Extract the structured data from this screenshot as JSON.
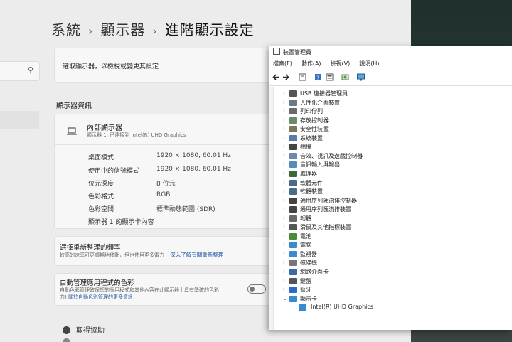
{
  "settings": {
    "breadcrumb": [
      "系統",
      "顯示器",
      "進階顯示設定"
    ],
    "select_display_label": "選取顯示器，以檢視或變更其設定",
    "display_info_title": "顯示器資訊",
    "display": {
      "name": "內部顯示器",
      "subtitle": "顯示器 1: 已連接到 Intel(R) UHD Graphics"
    },
    "specs": [
      {
        "label": "桌面模式",
        "value": "1920 × 1080, 60.01 Hz"
      },
      {
        "label": "使用中的信號模式",
        "value": "1920 × 1080, 60.01 Hz"
      },
      {
        "label": "位元深度",
        "value": "8 位元"
      },
      {
        "label": "色彩格式",
        "value": "RGB"
      },
      {
        "label": "色彩空間",
        "value": "標準動態範圍 (SDR)"
      }
    ],
    "adapter_link": "顯示器 1 的顯示卡內容",
    "refresh": {
      "title": "選擇重新整理的頻率",
      "desc": "較高的速率可更順暢地移動，但也使用更多電力",
      "link": "深入了解有關重新整理"
    },
    "auto_color": {
      "title": "自動管理應用程式的色彩",
      "desc": "自動色彩管理確保您的應用程式和其他內容在此顯示器上具有準確的色彩",
      "desc2": "力)",
      "link": "關於自動色彩管理的更多資訊"
    },
    "get_help": "取得協助"
  },
  "device_manager": {
    "title": "裝置管理員",
    "menu": [
      "檔案(F)",
      "動作(A)",
      "檢視(V)",
      "說明(H)"
    ],
    "categories": [
      {
        "label": "USB 連接器管理員",
        "expanded": false,
        "icon": "usb-icon"
      },
      {
        "label": "人性化介面裝置",
        "expanded": false,
        "icon": "hid-icon"
      },
      {
        "label": "列印佇列",
        "expanded": false,
        "icon": "printer-icon"
      },
      {
        "label": "存放控制器",
        "expanded": false,
        "icon": "storage-icon"
      },
      {
        "label": "安全性裝置",
        "expanded": false,
        "icon": "security-icon"
      },
      {
        "label": "系統裝置",
        "expanded": false,
        "icon": "system-icon"
      },
      {
        "label": "相機",
        "expanded": false,
        "icon": "camera-icon"
      },
      {
        "label": "音效、視訊及遊戲控制器",
        "expanded": false,
        "icon": "audio-icon"
      },
      {
        "label": "音訊輸入與輸出",
        "expanded": false,
        "icon": "speaker-icon"
      },
      {
        "label": "處理器",
        "expanded": false,
        "icon": "processor-icon"
      },
      {
        "label": "軟體元件",
        "expanded": false,
        "icon": "software-component-icon"
      },
      {
        "label": "軟體裝置",
        "expanded": false,
        "icon": "software-device-icon"
      },
      {
        "label": "通用序列匯流排控制器",
        "expanded": false,
        "icon": "usb-controller-icon"
      },
      {
        "label": "通用序列匯流排裝置",
        "expanded": false,
        "icon": "usb-device-icon"
      },
      {
        "label": "韌體",
        "expanded": false,
        "icon": "firmware-icon"
      },
      {
        "label": "滑鼠及其他指標裝置",
        "expanded": false,
        "icon": "mouse-icon"
      },
      {
        "label": "電池",
        "expanded": false,
        "icon": "battery-icon"
      },
      {
        "label": "電腦",
        "expanded": false,
        "icon": "computer-icon"
      },
      {
        "label": "監視器",
        "expanded": false,
        "icon": "monitor-icon"
      },
      {
        "label": "磁碟機",
        "expanded": false,
        "icon": "disk-icon"
      },
      {
        "label": "網路介面卡",
        "expanded": false,
        "icon": "network-icon"
      },
      {
        "label": "鍵盤",
        "expanded": false,
        "icon": "keyboard-icon"
      },
      {
        "label": "藍牙",
        "expanded": false,
        "icon": "bluetooth-icon"
      },
      {
        "label": "顯示卡",
        "expanded": true,
        "icon": "display-adapter-icon"
      }
    ],
    "child": "Intel(R) UHD Graphics"
  }
}
